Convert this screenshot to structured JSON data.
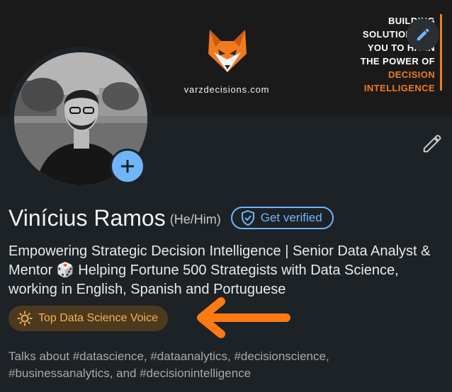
{
  "banner": {
    "brand_url": "varzdecisions.com",
    "tagline_lines": [
      "BUILDING",
      "SOLUTIONS TO",
      "YOU TO HARN",
      "THE POWER OF"
    ],
    "tagline_accent_lines": [
      "DECISION",
      "INTELLIGENCE"
    ]
  },
  "profile": {
    "name": "Vinícius Ramos",
    "pronouns": "(He/Him)",
    "verify_label": "Get verified",
    "headline": "Empowering Strategic Decision Intelligence | Senior Data Analyst & Mentor 🎲 Helping Fortune 500 Strategists with Data Science, working in English, Spanish and Portuguese",
    "badge_label": "Top Data Science Voice",
    "talks_about": "Talks about #datascience, #dataanalytics, #decisionscience, #businessanalytics, and #decisionintelligence"
  },
  "icons": {
    "banner_edit": "pencil-icon",
    "add_photo": "plus-icon",
    "profile_edit": "pencil-icon",
    "verify": "shield-check-icon",
    "badge": "sun-icon",
    "logo": "fox-logo"
  },
  "colors": {
    "background": "#1d2226",
    "accent_blue": "#70b5f9",
    "brand_orange": "#f07b1f",
    "badge_bg": "#4d3a1e",
    "badge_text": "#f0b257",
    "annotation_arrow": "#ff7a12"
  }
}
